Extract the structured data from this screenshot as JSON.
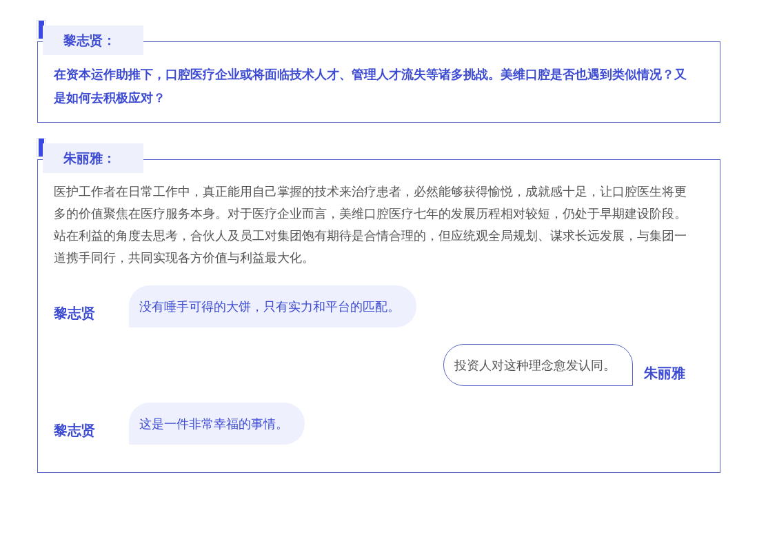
{
  "sections": [
    {
      "speaker": "黎志贤：",
      "kind": "question",
      "text": "在资本运作助推下，口腔医疗企业或将面临技术人才、管理人才流失等诸多挑战。美维口腔是否也遇到类似情况？又是如何去积极应对？"
    },
    {
      "speaker": "朱丽雅：",
      "kind": "answer",
      "text": "医护工作者在日常工作中，真正能用自己掌握的技术来治疗患者，必然能够获得愉悦，成就感十足，让口腔医生将更多的价值聚焦在医疗服务本身。对于医疗企业而言，美维口腔医疗七年的发展历程相对较短，仍处于早期建设阶段。站在利益的角度去思考，合伙人及员工对集团饱有期待是合情合理的，但应统观全局规划、谋求长远发展，与集团一道携手同行，共同实现各方价值与利益最大化。",
      "messages": [
        {
          "kind": "left",
          "speaker": "黎志贤",
          "text": "没有唾手可得的大饼，只有实力和平台的匹配。"
        },
        {
          "kind": "right",
          "speaker": "朱丽雅",
          "text": "投资人对这种理念愈发认同。"
        },
        {
          "kind": "left",
          "speaker": "黎志贤",
          "text": "这是一件非常幸福的事情。"
        }
      ]
    }
  ]
}
